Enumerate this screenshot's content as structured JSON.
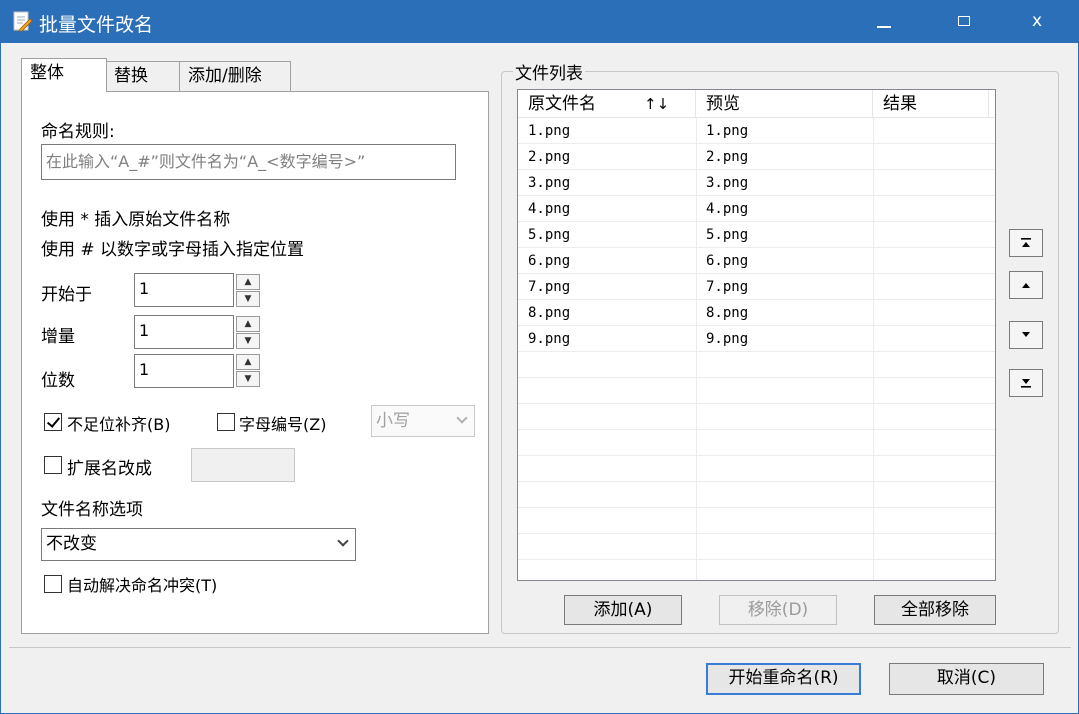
{
  "window": {
    "title": "批量文件改名",
    "minimize_label": "—",
    "close_label": "x"
  },
  "tabs": [
    {
      "label": "整体",
      "active": true
    },
    {
      "label": "替换",
      "active": false
    },
    {
      "label": "添加/删除",
      "active": false
    }
  ],
  "panel": {
    "rule_label": "命名规则:",
    "rule_input_placeholder": "在此输入“A_#”则文件名为“A_<数字编号>”",
    "hint1": "使用 * 插入原始文件名称",
    "hint2": "使用 # 以数字或字母插入指定位置",
    "start_label": "开始于",
    "start_value": "1",
    "increment_label": "增量",
    "increment_value": "1",
    "digits_label": "位数",
    "digits_value": "1",
    "pad_label": "不足位补齐(B)",
    "pad_checked": true,
    "letter_label": "字母编号(Z)",
    "letter_checked": false,
    "case_select_value": "小写",
    "ext_label": "扩展名改成",
    "ext_checked": false,
    "filename_option_label": "文件名称选项",
    "filename_option_value": "不改变",
    "auto_resolve_label": "自动解决命名冲突(T)",
    "auto_resolve_checked": false
  },
  "file_list": {
    "group_title": "文件列表",
    "columns": [
      "原文件名",
      "预览",
      "结果"
    ],
    "sort_glyph": "↑↓",
    "rows": [
      {
        "original": "1.png",
        "preview": "1.png",
        "result": ""
      },
      {
        "original": "2.png",
        "preview": "2.png",
        "result": ""
      },
      {
        "original": "3.png",
        "preview": "3.png",
        "result": ""
      },
      {
        "original": "4.png",
        "preview": "4.png",
        "result": ""
      },
      {
        "original": "5.png",
        "preview": "5.png",
        "result": ""
      },
      {
        "original": "6.png",
        "preview": "6.png",
        "result": ""
      },
      {
        "original": "7.png",
        "preview": "7.png",
        "result": ""
      },
      {
        "original": "8.png",
        "preview": "8.png",
        "result": ""
      },
      {
        "original": "9.png",
        "preview": "9.png",
        "result": ""
      }
    ],
    "add_button": "添加(A)",
    "remove_button": "移除(D)",
    "remove_all_button": "全部移除"
  },
  "footer": {
    "start_rename_button": "开始重命名(R)",
    "cancel_button": "取消(C)"
  },
  "colors": {
    "titlebar": "#2b6fb8",
    "window_bg": "#f0f0f0",
    "default_button_border": "#3a7bd5"
  }
}
